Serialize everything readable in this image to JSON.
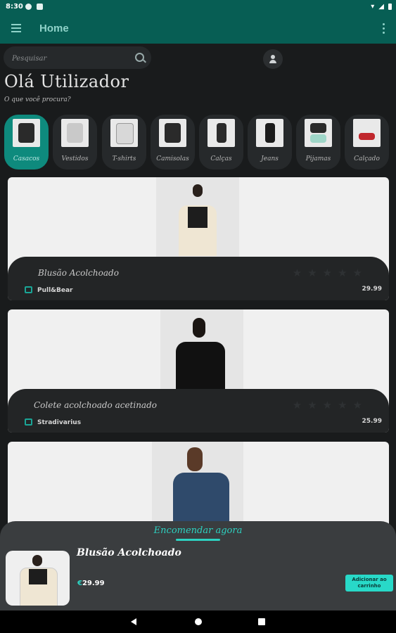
{
  "status_bar": {
    "time": "8:30"
  },
  "app_bar": {
    "title": "Home"
  },
  "search": {
    "placeholder": "Pesquisar"
  },
  "greeting": {
    "title": "Olá Utilizador",
    "subtitle": "O que você procura?"
  },
  "categories": [
    {
      "label": "Casacos",
      "active": true
    },
    {
      "label": "Vestidos",
      "active": false
    },
    {
      "label": "T-shirts",
      "active": false
    },
    {
      "label": "Camisolas",
      "active": false
    },
    {
      "label": "Calças",
      "active": false
    },
    {
      "label": "Jeans",
      "active": false
    },
    {
      "label": "Pijamas",
      "active": false
    },
    {
      "label": "Calçado",
      "active": false
    }
  ],
  "products": [
    {
      "name": "Blusão Acolchoado",
      "store": "Pull&Bear",
      "price": "29.99"
    },
    {
      "name": "Colete acolchoado acetinado",
      "store": "Stradivarius",
      "price": "25.99"
    },
    {
      "name": "",
      "store": "",
      "price": ""
    }
  ],
  "order_sheet": {
    "title": "Encomendar agora",
    "product_name": "Blusão Acolchoado",
    "currency": "€",
    "price": "29.99",
    "add_button": "Adicionar ao carrinho"
  },
  "colors": {
    "primary": "#075e54",
    "accent": "#2dd2c1",
    "active_category": "#0e8a7d"
  },
  "icons": [
    "menu-icon",
    "more-vert-icon",
    "search-icon",
    "user-icon",
    "store-icon",
    "star-icon",
    "back-icon",
    "home-icon",
    "recents-icon"
  ]
}
